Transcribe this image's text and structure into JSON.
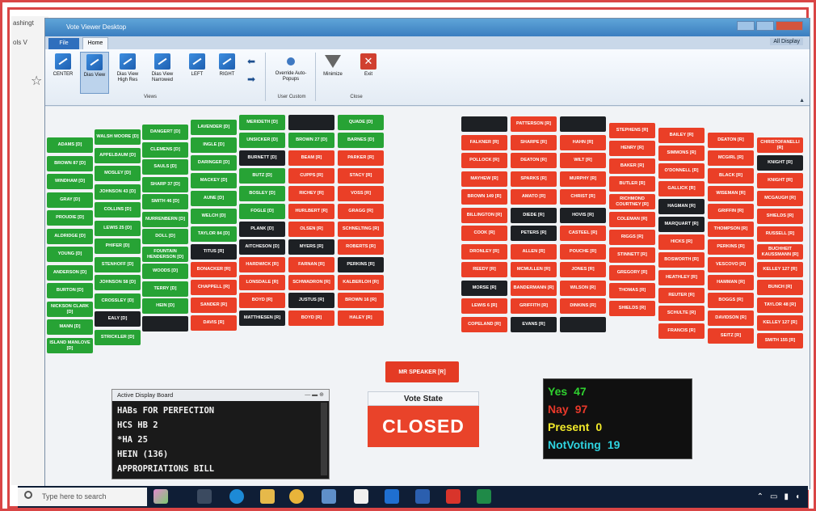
{
  "window": {
    "title": "Vote Viewer Desktop",
    "help_label": "All Display"
  },
  "tabs": [
    {
      "label": "File"
    },
    {
      "label": "Home"
    }
  ],
  "ribbon": {
    "buttons": [
      "CENTER",
      "Dias View",
      "Dias View High Res",
      "Dias View Narrowed",
      "LEFT",
      "RIGHT",
      "Override Auto-Popups",
      "Minimize",
      "Exit"
    ],
    "groups": [
      "Views",
      "User Custom",
      "Close"
    ]
  },
  "seats_green": [
    "ADAMS [D]",
    "BROWN 87 [D]",
    "WINDHAM [D]",
    "GRAY [D]",
    "PROUDIE [D]",
    "ALDRIDGE [D]",
    "YOUNG [D]",
    "ANDERSON [D]",
    "BURTON [D]",
    "NICKSON CLARK [D]",
    "MANN [D]",
    "ISLAND MANLOVE [D]",
    "WALSH MOORE [D]",
    "APPELBAUM [D]",
    "MOSLEY [D]",
    "JOHNSON 43 [D]",
    "COLLINS [D]",
    "LEWIS 25 [D]",
    "PHIFER [D]",
    "STENHOFF [D]",
    "JOHNSON 58 [D]",
    "CROSSLEY [D]",
    "STRICKLER [D]",
    "DANGERT [D]",
    "CLEMENS [D]",
    "SAULS [D]",
    "SHARP 37 [D]",
    "SMITH 46 [D]",
    "NURRENBERN [D]",
    "DOLL [D]",
    "FOUNTAIN HENDERSON [D]",
    "WOODS [D]",
    "TERRY [D]",
    "HEIN [D]",
    "LAVENDER [D]",
    "INGLE [D]",
    "DARINGER [D]",
    "MACKEY [D]",
    "AUNE [D]",
    "WELCH [D]",
    "TAYLOR 84 [D]",
    "MERIDETH [D]",
    "UNSICKER [D]",
    "BUTZ [D]",
    "BOSLEY [D]",
    "FOGLE [D]",
    "BROWN 27 [D]",
    "QUADE [D]",
    "BARNES [D]"
  ],
  "seats_black": [
    "EALY [D]",
    "BURNETT [D]",
    "PLANK [D]",
    "AITCHESON [D]",
    "TITUS [R]",
    "MATTHIESEN [R]",
    "JUSTUS [R]",
    "MYERS [R]",
    "PERKINS [R]",
    "SEITZ [R]",
    "KNIGHT [R]",
    "HAGMAN [R]",
    "MARQUART [R]",
    "PETERS [R]",
    "MORSE [R]",
    "EVANS [R]",
    "DIEDE [R]",
    "HOVIS [R]"
  ],
  "seats_red": [
    "BEAM [R]",
    "CUPPS [R]",
    "RICHEY [R]",
    "HURLBERT [R]",
    "OLSEN [R]",
    "BONACKER [R]",
    "CHAPPELL [R]",
    "SANDER [R]",
    "DAVIS [R]",
    "HARDWICK [R]",
    "LONSDALE [R]",
    "BOYD [R]",
    "PARKER [R]",
    "STACY [R]",
    "VOSS [R]",
    "GRAGG [R]",
    "SCHNELTING [R]",
    "ROBERTS [R]",
    "FARNAN [R]",
    "SCHWADRON [R]",
    "KALBERLOH [R]",
    "BROWN 16 [R]",
    "HALEY [R]",
    "PATTERSON [R]",
    "FALKNER [R]",
    "POLLOCK [R]",
    "MAYHEW [R]",
    "BROWN 149 [R]",
    "BILLINGTON [R]",
    "COOK [R]",
    "DRONLEY [R]",
    "REEDY [R]",
    "LEWIS 6 [R]",
    "COPELAND [R]",
    "SHARPE [R]",
    "DEATON [R]",
    "SPARKS [R]",
    "AMATO [R]",
    "ALLEN [R]",
    "MCMULLEN [R]",
    "BANDERMANN [R]",
    "GRIFFITH [R]",
    "HAHN [R]",
    "WILT [R]",
    "MURPHY [R]",
    "CHRIST [R]",
    "CASTEEL [R]",
    "POUCHE [R]",
    "JONES [R]",
    "WILSON [R]",
    "DINKINS [R]",
    "STEPHENS [R]",
    "HENRY [R]",
    "BAKER [R]",
    "BUTLER [R]",
    "RICHMOND COURTNEY [R]",
    "COLEMAN [R]",
    "RIGGS [R]",
    "STINNETT [R]",
    "GREGORY [R]",
    "THOMAS [R]",
    "SHIELDS [R]",
    "BAILEY [R]",
    "SIMMONS [R]",
    "O'DONNELL [R]",
    "GALLICK [R]",
    "HICKS [R]",
    "BOSWORTH [R]",
    "HEATHLEY [R]",
    "REUTER [R]",
    "SCHULTE [R]",
    "FRANCIS [R]",
    "DEATON [R]",
    "MCGIRL [R]",
    "BLACK [R]",
    "WISEMAN [R]",
    "GRIFFIN [R]",
    "THOMPSON [R]",
    "PERKINS [R]",
    "VESCOVO [R]",
    "HAMMAN [R]",
    "BOGGS [R]",
    "DAVIDSON [R]",
    "SEITZ [R]",
    "CHRISTOFANELLI [R]",
    "KNIGHT [R]",
    "MCGAUGH [R]",
    "SHIELDS [R]",
    "RUSSELL [R]",
    "BUCHHEIT KAUSSMANN [R]",
    "KELLEY 127 [R]",
    "BUNCH [R]",
    "TAYLOR 48 [R]",
    "KELLEY 127 [R]",
    "SMITH 155 [R]"
  ],
  "speaker": {
    "label": "MR SPEAKER [R]"
  },
  "board": {
    "title": "Active Display Board",
    "lines": [
      "HABs FOR PERFECTION",
      "HCS HB 2",
      "*HA 25",
      "HEIN (136)",
      "APPROPRIATIONS BILL"
    ]
  },
  "vote_state": {
    "label": "Vote State",
    "value": "CLOSED"
  },
  "tally": [
    {
      "label": "Yes",
      "value": "47",
      "color": "#2fd12f"
    },
    {
      "label": "Nay",
      "value": "97",
      "color": "#e8382a"
    },
    {
      "label": "Present",
      "value": "0",
      "color": "#f2ea2a"
    },
    {
      "label": "NotVoting",
      "value": "19",
      "color": "#2ed3e0"
    }
  ],
  "taskbar": {
    "search_placeholder": "Type here to search"
  }
}
